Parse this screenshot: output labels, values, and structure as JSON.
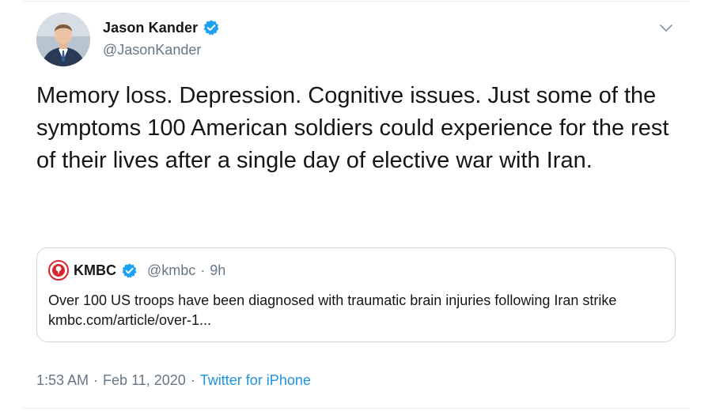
{
  "author": {
    "display_name": "Jason Kander",
    "handle": "@JasonKander",
    "verified_icon": "verified-badge-icon",
    "avatar_icon": "avatar"
  },
  "menu": {
    "caret_icon": "chevron-down-icon"
  },
  "tweet": {
    "text": "Memory loss. Depression. Cognitive issues. Just some of the symptoms 100 American soldiers could experience for the rest of their lives after a single day of elective war with Iran."
  },
  "quoted": {
    "display_name": "KMBC",
    "handle": "@kmbc",
    "separator": "·",
    "time": "9h",
    "text": "Over 100 US troops have been diagnosed with traumatic brain injuries following Iran strike kmbc.com/article/over-1...",
    "logo_icon": "kmbc-logo-icon"
  },
  "meta": {
    "time": "1:53 AM",
    "sep1": "·",
    "date": "Feb 11, 2020",
    "sep2": "·",
    "source": "Twitter for iPhone"
  },
  "colors": {
    "verified_blue": "#1da1f2",
    "link_blue": "#1b95e0",
    "secondary_text": "#657786",
    "border": "#ccd6dd",
    "kmbc_red": "#d7262f"
  }
}
